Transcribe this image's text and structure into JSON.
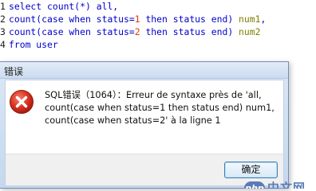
{
  "editor": {
    "lines": [
      {
        "number": "1",
        "tokens": [
          "select count(*) all,"
        ]
      },
      {
        "number": "2",
        "tokens": [
          "count(case when status=",
          "1",
          " then status end) ",
          "num1",
          ","
        ]
      },
      {
        "number": "3",
        "tokens": [
          "count(case when status=",
          "2",
          " then status end) ",
          "num2"
        ]
      },
      {
        "number": "4",
        "tokens": [
          "from user"
        ]
      }
    ]
  },
  "dialog": {
    "title": "错误",
    "message_lines": [
      "SQL错误（1064）：Erreur de syntaxe près de 'all,",
      "count(case when status=1 then status end) num1,",
      "count(case when status=2' à la ligne 1"
    ],
    "ok_label": "确定",
    "icon": "error-icon",
    "icon_color": "#c8281e"
  },
  "watermark": {
    "logo_text": "php",
    "text": "中文网"
  }
}
